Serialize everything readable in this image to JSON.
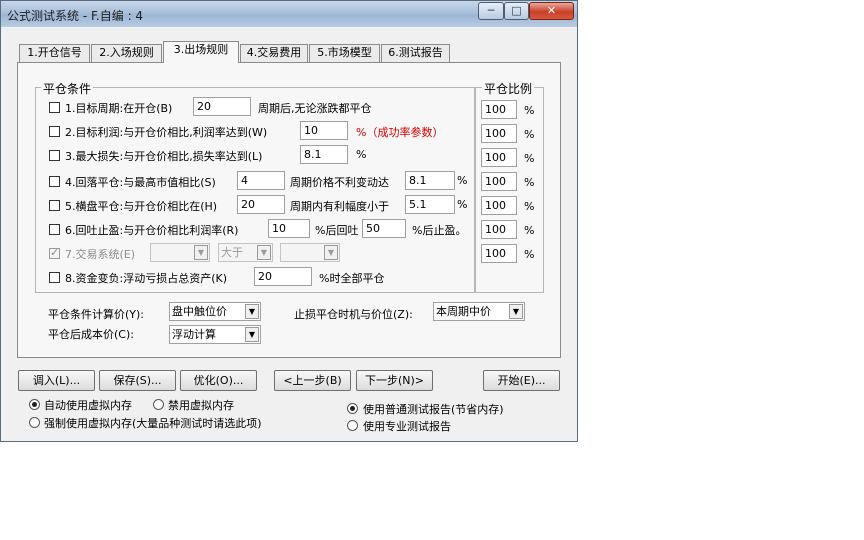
{
  "window": {
    "title": "公式测试系统 - F.自编 : 4",
    "minimize": "─",
    "maximize": "□",
    "close": "✕"
  },
  "tabs": [
    {
      "label": "1.开仓信号"
    },
    {
      "label": "2.入场规则"
    },
    {
      "label": "3.出场规则",
      "active": true
    },
    {
      "label": "4.交易费用"
    },
    {
      "label": "5.市场模型"
    },
    {
      "label": "6.测试报告"
    }
  ],
  "exit": {
    "group_title": "平仓条件",
    "ratio_title": "平仓比例",
    "rows": {
      "r1": {
        "label": "1.目标周期:在开仓(B)",
        "value": "20",
        "suffix": "周期后,无论涨跌都平仓",
        "ratio": "100",
        "pct": "%"
      },
      "r2": {
        "label": "2.目标利润:与开仓价相比,利润率达到(W)",
        "value": "10",
        "suffix": "%（成功率参数）",
        "ratio": "100",
        "pct": "%"
      },
      "r3": {
        "label": "3.最大损失:与开仓价相比,损失率达到(L)",
        "value": "8.1",
        "suffix": "%",
        "ratio": "100",
        "pct": "%"
      },
      "r4": {
        "label": "4.回落平仓:与最高市值相比(S)",
        "value": "4",
        "mid": "周期价格不利变动达",
        "value2": "8.1",
        "suffix": "%",
        "ratio": "100",
        "pct": "%"
      },
      "r5": {
        "label": "5.横盘平仓:与开仓价相比在(H)",
        "value": "20",
        "mid": "周期内有利幅度小于",
        "value2": "5.1",
        "suffix": "%",
        "ratio": "100",
        "pct": "%"
      },
      "r6": {
        "label": "6.回吐止盈:与开仓价相比利润率(R)",
        "value": "10",
        "mid": "%后回吐",
        "value2": "50",
        "suffix": "%后止盈。",
        "ratio": "100",
        "pct": "%"
      },
      "r7": {
        "label": "7.交易系统(E)",
        "combo1": "",
        "combo2": "大于",
        "combo3": "",
        "ratio": "100",
        "pct": "%",
        "checked": true,
        "disabled": true
      },
      "r8": {
        "label": "8.资金变负:浮动亏损占总资产(K)",
        "value": "20",
        "suffix": "%时全部平仓"
      }
    },
    "calc_price_label": "平仓条件计算价(Y):",
    "calc_price_value": "盘中触位价",
    "stoploss_label": "止损平仓时机与价位(Z):",
    "stoploss_value": "本周期中价",
    "cost_label": "平仓后成本价(C):",
    "cost_value": "浮动计算"
  },
  "buttons": {
    "load": "调入(L)...",
    "save": "保存(S)...",
    "optimize": "优化(O)...",
    "prev": "<上一步(B)",
    "next": "下一步(N)>",
    "start": "开始(E)..."
  },
  "options": {
    "auto_vm": "自动使用虚拟内存",
    "disable_vm": "禁用虚拟内存",
    "force_vm": "强制使用虚拟内存(大量品种测试时请选此项)",
    "normal_report": "使用普通测试报告(节省内存)",
    "pro_report": "使用专业测试报告"
  }
}
